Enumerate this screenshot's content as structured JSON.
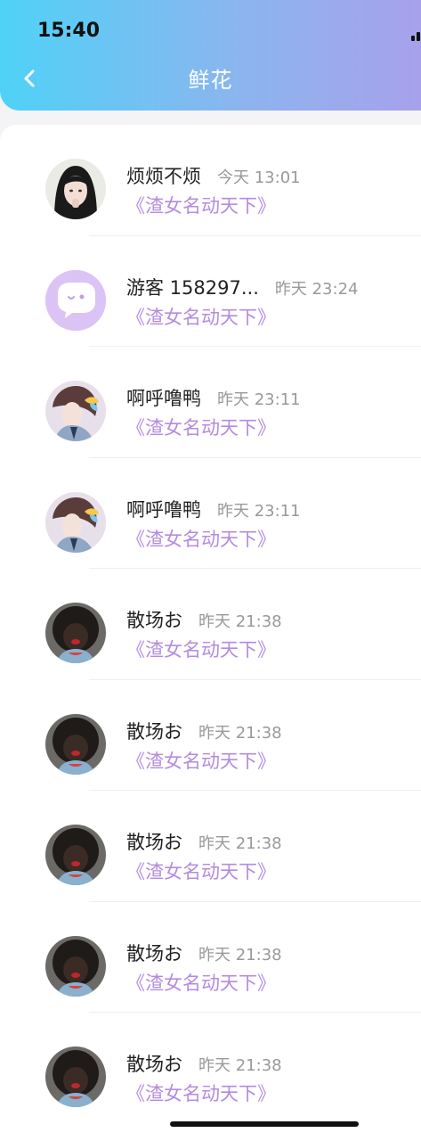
{
  "status_bar": {
    "time": "15:40"
  },
  "header": {
    "title": "鲜花"
  },
  "items": [
    {
      "name": "烦烦不烦",
      "time": "今天 13:01",
      "work": "《渣女名动天下》",
      "avatar": "girl-photo"
    },
    {
      "name": "游客 158297...",
      "time": "昨天 23:24",
      "work": "《渣女名动天下》",
      "avatar": "guest-chat-bubble"
    },
    {
      "name": "啊呼噜鸭",
      "time": "昨天 23:11",
      "work": "《渣女名动天下》",
      "avatar": "anime-character"
    },
    {
      "name": "啊呼噜鸭",
      "time": "昨天 23:11",
      "work": "《渣女名动天下》",
      "avatar": "anime-character"
    },
    {
      "name": "散场お",
      "time": "昨天 21:38",
      "work": "《渣女名动天下》",
      "avatar": "curly-hair-kid"
    },
    {
      "name": "散场お",
      "time": "昨天 21:38",
      "work": "《渣女名动天下》",
      "avatar": "curly-hair-kid"
    },
    {
      "name": "散场お",
      "time": "昨天 21:38",
      "work": "《渣女名动天下》",
      "avatar": "curly-hair-kid"
    },
    {
      "name": "散场お",
      "time": "昨天 21:38",
      "work": "《渣女名动天下》",
      "avatar": "curly-hair-kid"
    },
    {
      "name": "散场お",
      "time": "昨天 21:38",
      "work": "《渣女名动天下》",
      "avatar": "curly-hair-kid"
    }
  ],
  "colors": {
    "header_start": "#4fd2f7",
    "header_end": "#a7a1eb",
    "accent": "#b48be0"
  }
}
